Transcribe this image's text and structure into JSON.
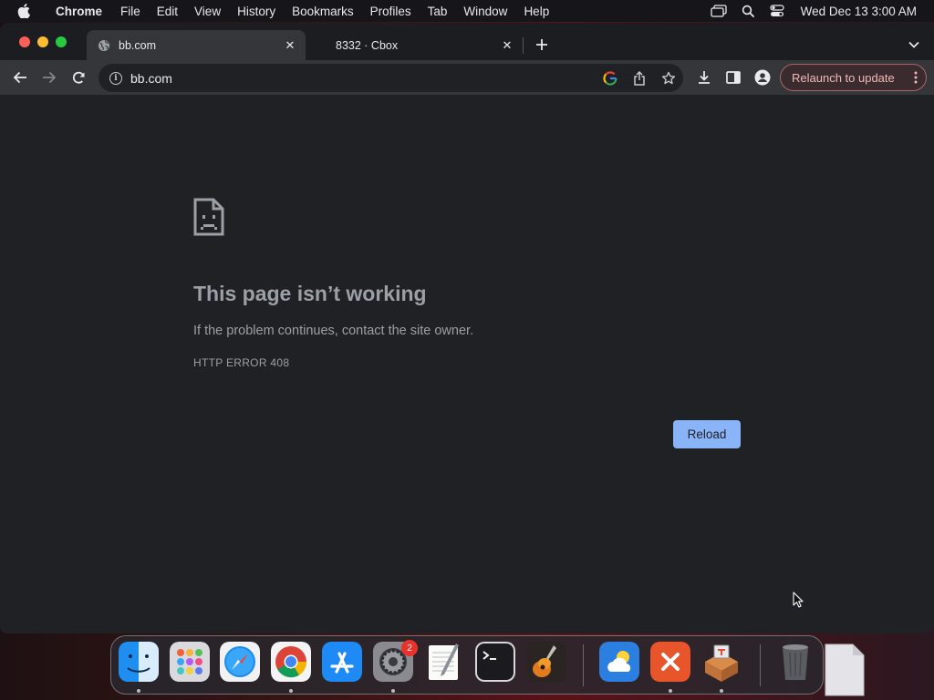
{
  "menubar": {
    "app_name": "Chrome",
    "items": [
      "File",
      "Edit",
      "View",
      "History",
      "Bookmarks",
      "Profiles",
      "Tab",
      "Window",
      "Help"
    ],
    "clock": "Wed Dec 13  3:00 AM",
    "status_icons": [
      "screen-mirroring-icon",
      "spotlight-icon",
      "control-center-icon"
    ]
  },
  "tabs": [
    {
      "title": "bb.com",
      "active": true,
      "icon": "globe-icon"
    },
    {
      "title": "8332 · Cbox",
      "active": false
    }
  ],
  "toolbar": {
    "url": "bb.com",
    "relaunch_label": "Relaunch to update"
  },
  "error_page": {
    "title": "This page isn’t working",
    "description": "If the problem continues, contact the site owner.",
    "error_code": "HTTP ERROR 408",
    "reload_label": "Reload"
  },
  "dock": {
    "apps": [
      "Finder",
      "Launchpad",
      "Safari",
      "Google Chrome",
      "App Store",
      "System Preferences",
      "TextEdit",
      "Terminal",
      "GarageBand",
      "Weather",
      "Remote Desktop",
      "Archive Utility",
      "Trash"
    ],
    "system_preferences_badge": "2"
  },
  "colors": {
    "accent": "#8ab4f8",
    "window_bg": "#202124",
    "toolbar_bg": "#35363a",
    "relaunch_text": "#f2b8b5"
  }
}
